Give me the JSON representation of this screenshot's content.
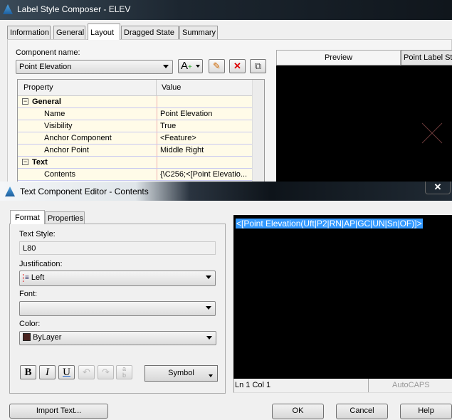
{
  "main_window": {
    "title": "Label Style Composer - ELEV",
    "tabs": [
      "Information",
      "General",
      "Layout",
      "Dragged State",
      "Summary"
    ],
    "component_name_label": "Component name:",
    "component_name": "Point Elevation",
    "preview_tabs": [
      "Preview",
      "Point Label Sty"
    ],
    "grid": {
      "headers": [
        "Property",
        "Value"
      ],
      "rows": [
        {
          "type": "category",
          "key": "General"
        },
        {
          "key": "Name",
          "value": "Point Elevation"
        },
        {
          "key": "Visibility",
          "value": "True"
        },
        {
          "key": "Anchor Component",
          "value": "<Feature>"
        },
        {
          "key": "Anchor Point",
          "value": "Middle Right"
        },
        {
          "type": "category",
          "key": "Text"
        },
        {
          "key": "Contents",
          "value": "{\\C256;<[Point Elevatio..."
        }
      ]
    }
  },
  "editor": {
    "title": "Text Component Editor - Contents",
    "tabs": [
      "Format",
      "Properties"
    ],
    "text_style_label": "Text Style:",
    "text_style": "L80",
    "justification_label": "Justification:",
    "justification": "Left",
    "font_label": "Font:",
    "font": "",
    "color_label": "Color:",
    "color": "ByLayer",
    "color_swatch": "#4a2420",
    "format_buttons": [
      "B",
      "I",
      "U"
    ],
    "symbol_label": "Symbol",
    "import_label": "Import Text...",
    "content": "<[Point Elevation(Uft|P2|RN|AP|GC|UN|Sn|OF)]>",
    "status_position": "Ln 1 Col 1",
    "status_caps": "AutoCAPS",
    "ok_label": "OK",
    "cancel_label": "Cancel",
    "help_label": "Help",
    "selection_color": "#3399ff"
  }
}
